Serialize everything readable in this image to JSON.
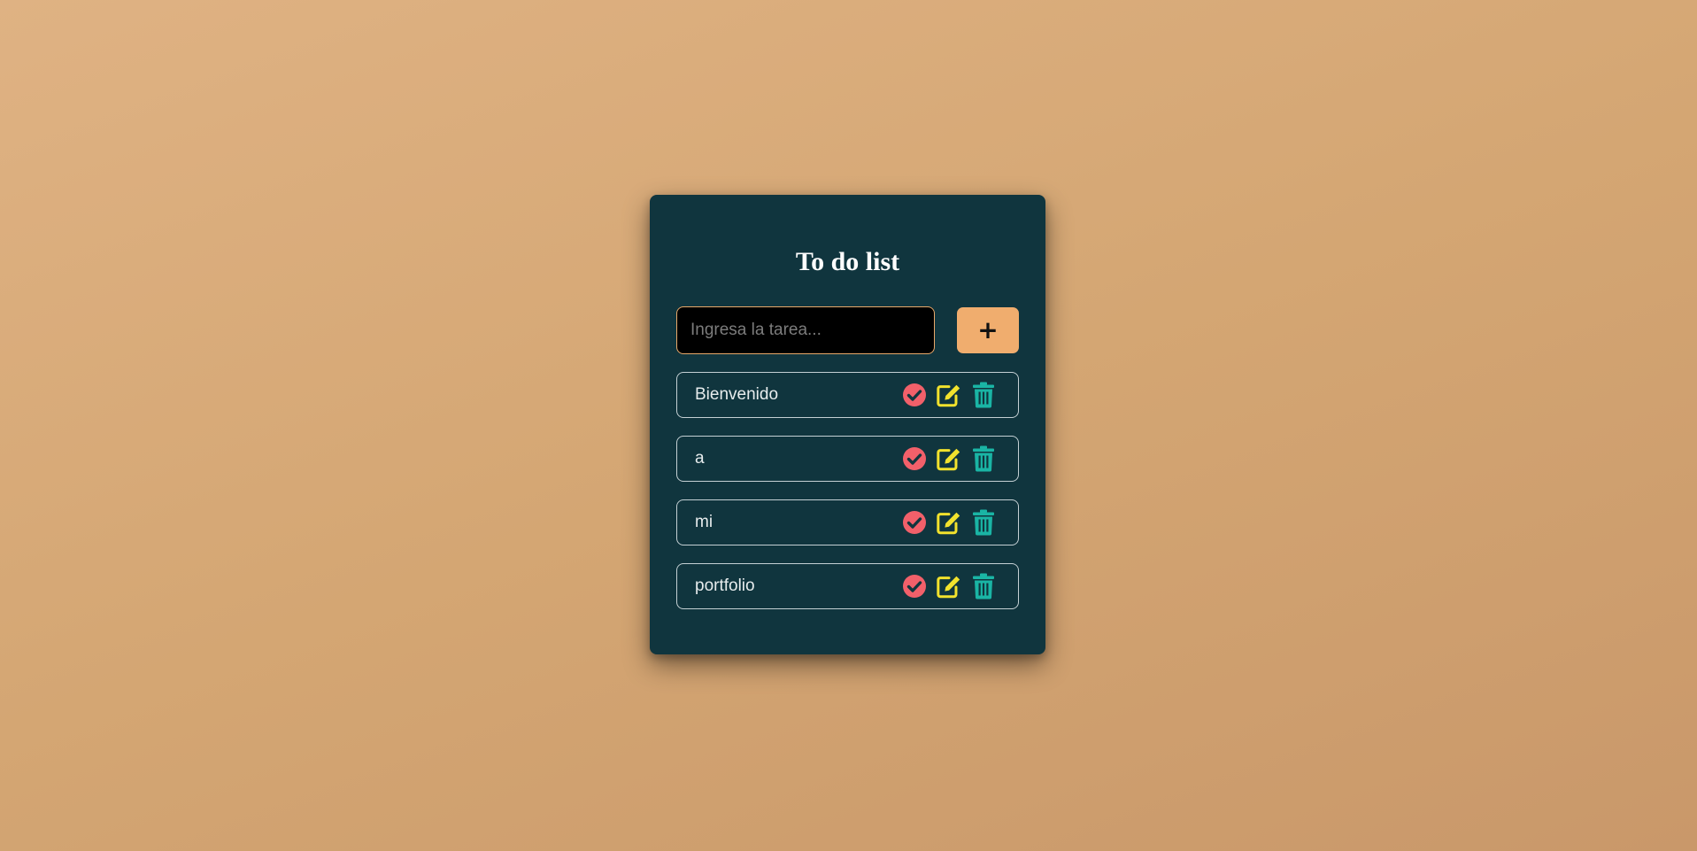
{
  "app": {
    "title": "To do list"
  },
  "input": {
    "placeholder": "Ingresa la tarea...",
    "value": ""
  },
  "add_button": {
    "label": "+"
  },
  "colors": {
    "card_bg": "#10353e",
    "accent": "#f0ad6e",
    "complete_icon": "#f2606a",
    "edit_icon": "#f2e22d",
    "delete_icon": "#1ab5a5"
  },
  "tasks": [
    {
      "text": "Bienvenido",
      "icons": [
        "check-circle-icon",
        "edit-icon",
        "trash-icon"
      ]
    },
    {
      "text": "a",
      "icons": [
        "check-circle-icon",
        "edit-icon",
        "trash-icon"
      ]
    },
    {
      "text": "mi",
      "icons": [
        "check-circle-icon",
        "edit-icon",
        "trash-icon"
      ]
    },
    {
      "text": "portfolio",
      "icons": [
        "check-circle-icon",
        "edit-icon",
        "trash-icon"
      ]
    }
  ]
}
